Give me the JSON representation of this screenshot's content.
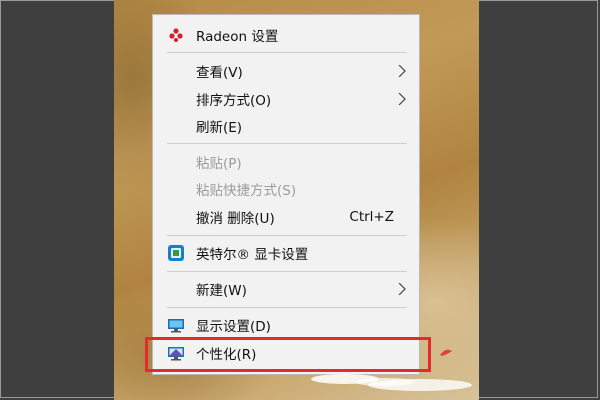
{
  "menu": {
    "radeon": {
      "label": "Radeon 设置",
      "icon": "amd-radeon-icon"
    },
    "view": {
      "label": "查看(V)",
      "icon": "chevron-right-icon"
    },
    "sort": {
      "label": "排序方式(O)",
      "icon": "chevron-right-icon"
    },
    "refresh": {
      "label": "刷新(E)"
    },
    "paste": {
      "label": "粘贴(P)",
      "disabled": true
    },
    "paste_shortcut": {
      "label": "粘贴快捷方式(S)",
      "disabled": true
    },
    "undo_delete": {
      "label": "撤消 删除(U)",
      "shortcut": "Ctrl+Z"
    },
    "intel": {
      "label": "英特尔® 显卡设置",
      "icon": "intel-graphics-icon"
    },
    "new": {
      "label": "新建(W)",
      "icon": "chevron-right-icon"
    },
    "display": {
      "label": "显示设置(D)",
      "icon": "display-icon"
    },
    "personalize": {
      "label": "个性化(R)",
      "icon": "personalize-icon"
    }
  },
  "annotation": {
    "highlight_color": "#e32b2b"
  }
}
